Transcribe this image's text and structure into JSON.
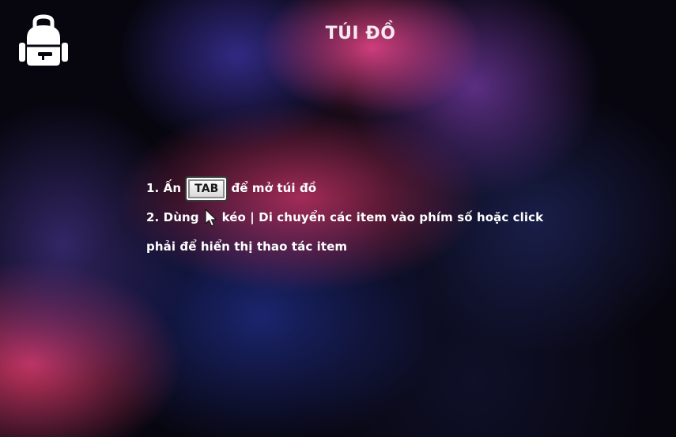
{
  "header": {
    "title": "TÚI ĐỒ",
    "logo_icon": "backpack-icon"
  },
  "instructions": {
    "line1_before": "1. Ấn",
    "tab_key": "TAB",
    "line1_after": "để mở túi đồ",
    "line2_before": "2. Dùng",
    "cursor_icon": "mouse-cursor-icon",
    "line2_after": "kéo | Di chuyển các item vào phím số hoặc click",
    "line3": "phải để hiển thị thao tác item"
  },
  "colors": {
    "background": "#07060f",
    "accent_pink": "#e8467e",
    "accent_blue": "#2b3a9e",
    "accent_purple": "#6a3cb0",
    "text": "#ffffff"
  }
}
